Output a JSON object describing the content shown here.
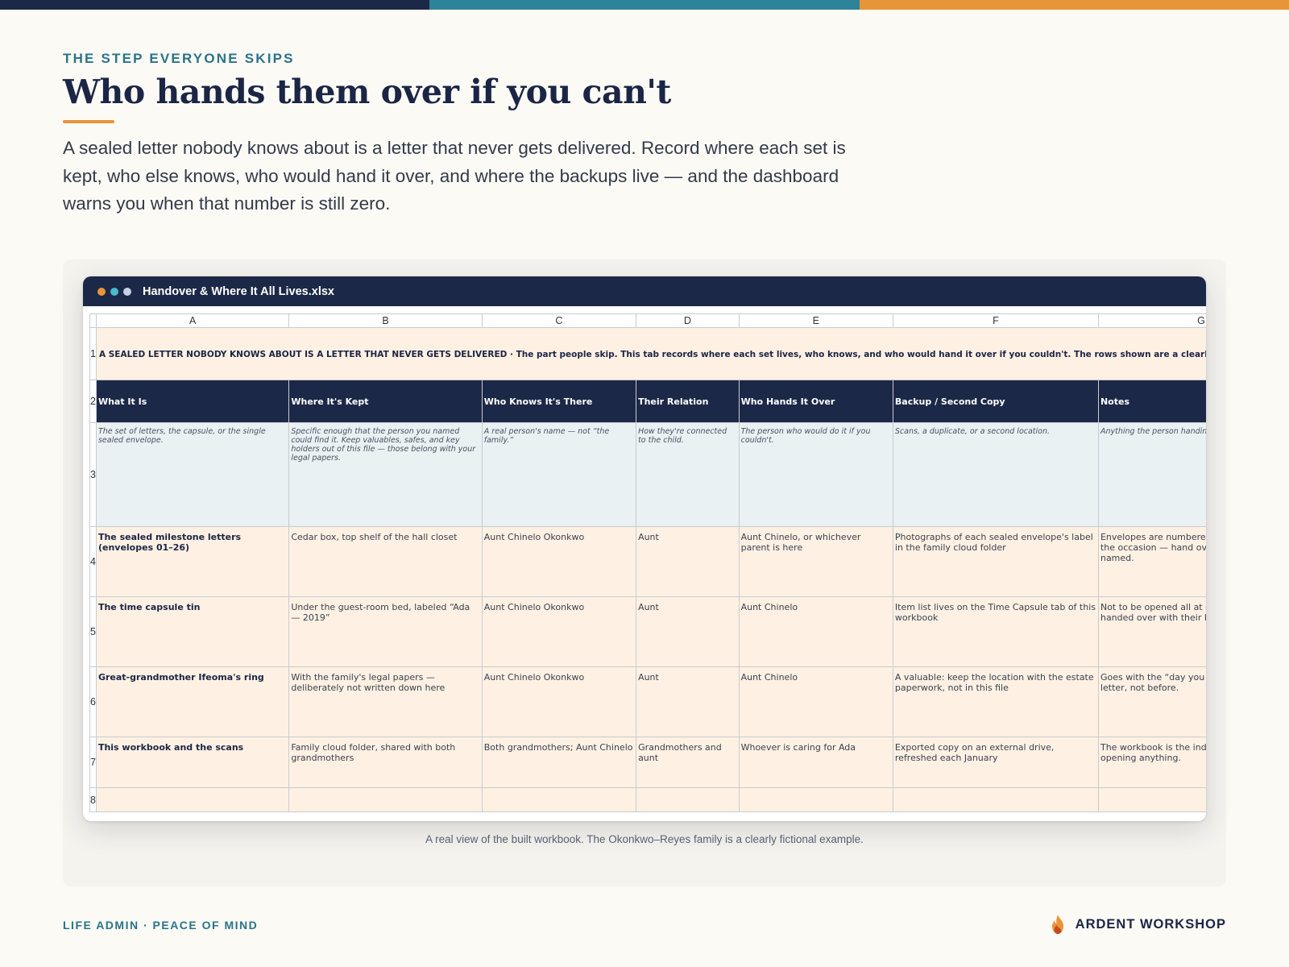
{
  "colors": {
    "accent_orange": "#e8953a",
    "accent_teal": "#2a7388",
    "navy": "#1c2847",
    "topbar": [
      "#1c2847",
      "#2d8398",
      "#e8953a"
    ],
    "window_dots": [
      "#e8953a",
      "#4cb8cc",
      "#c8d1e0"
    ]
  },
  "hero": {
    "eyebrow": "THE STEP EVERYONE SKIPS",
    "title": "Who hands them over if you can't",
    "lede": "A sealed letter nobody knows about is a letter that never gets delivered. Record where each set is kept, who else knows, who would hand it over, and where the backups live — and the dashboard warns you when that number is still zero."
  },
  "window": {
    "title": "Handover & Where It All Lives.xlsx"
  },
  "sheet": {
    "columns": [
      "A",
      "B",
      "C",
      "D",
      "E",
      "F",
      "G"
    ],
    "row_numbers": [
      "1",
      "2",
      "3",
      "4",
      "5",
      "6",
      "7",
      "8"
    ],
    "banner": "A SEALED LETTER NOBODY KNOWS ABOUT IS A LETTER THAT NEVER GETS DELIVERED  ·  The part people skip. This tab records where each set lives, who knows, and who would hand it over if you couldn't. The rows shown are a clearly fictional example.",
    "headers": [
      "What It Is",
      "Where It's Kept",
      "Who Knows It's There",
      "Their Relation",
      "Who Hands It Over",
      "Backup / Second Copy",
      "Notes"
    ],
    "hints": [
      "The set of letters, the capsule, or the single sealed envelope.",
      "Specific enough that the person you named could find it. Keep valuables, safes, and key holders out of this file — those belong with your legal papers.",
      "A real person's name — not “the family.”",
      "How they're connected to the child.",
      "The person who would do it if you couldn't.",
      "Scans, a duplicate, or a second location.",
      "Anything the person handing it over needs to know."
    ],
    "rows": [
      [
        "The sealed milestone letters (envelopes 01–26)",
        "Cedar box, top shelf of the hall closet",
        "Aunt Chinelo Okonkwo",
        "Aunt",
        "Aunt Chinelo, or whichever parent is here",
        "Photographs of each sealed envelope's label in the family cloud folder",
        "Envelopes are numbered and labeled with the occasion — hand over only the one named."
      ],
      [
        "The time capsule tin",
        "Under the guest-room bed, labeled “Ada — 2019”",
        "Aunt Chinelo Okonkwo",
        "Aunt",
        "Aunt Chinelo",
        "Item list lives on the Time Capsule tab of this workbook",
        "Not to be opened all at once — items are handed over with their letters."
      ],
      [
        "Great-grandmother Ifeoma's ring",
        "With the family's legal papers — deliberately not written down here",
        "Aunt Chinelo Okonkwo",
        "Aunt",
        "Aunt Chinelo",
        "A valuable: keep the location with the estate paperwork, not in this file",
        "Goes with the “day you choose your person” letter, not before."
      ],
      [
        "This workbook and the scans",
        "Family cloud folder, shared with both grandmothers",
        "Both grandmothers; Aunt Chinelo",
        "Grandmothers and aunt",
        "Whoever is caring for Ada",
        "Exported copy on an external drive, refreshed each January",
        "The workbook is the index — read it before opening anything."
      ],
      [
        "",
        "",
        "",
        "",
        "",
        "",
        ""
      ]
    ]
  },
  "caption": "A real view of the built workbook. The Okonkwo–Reyes family is a clearly fictional example.",
  "footer": {
    "left": "LIFE ADMIN · PEACE OF MIND",
    "brand": "ARDENT WORKSHOP",
    "brand_icon": "flame-icon"
  }
}
